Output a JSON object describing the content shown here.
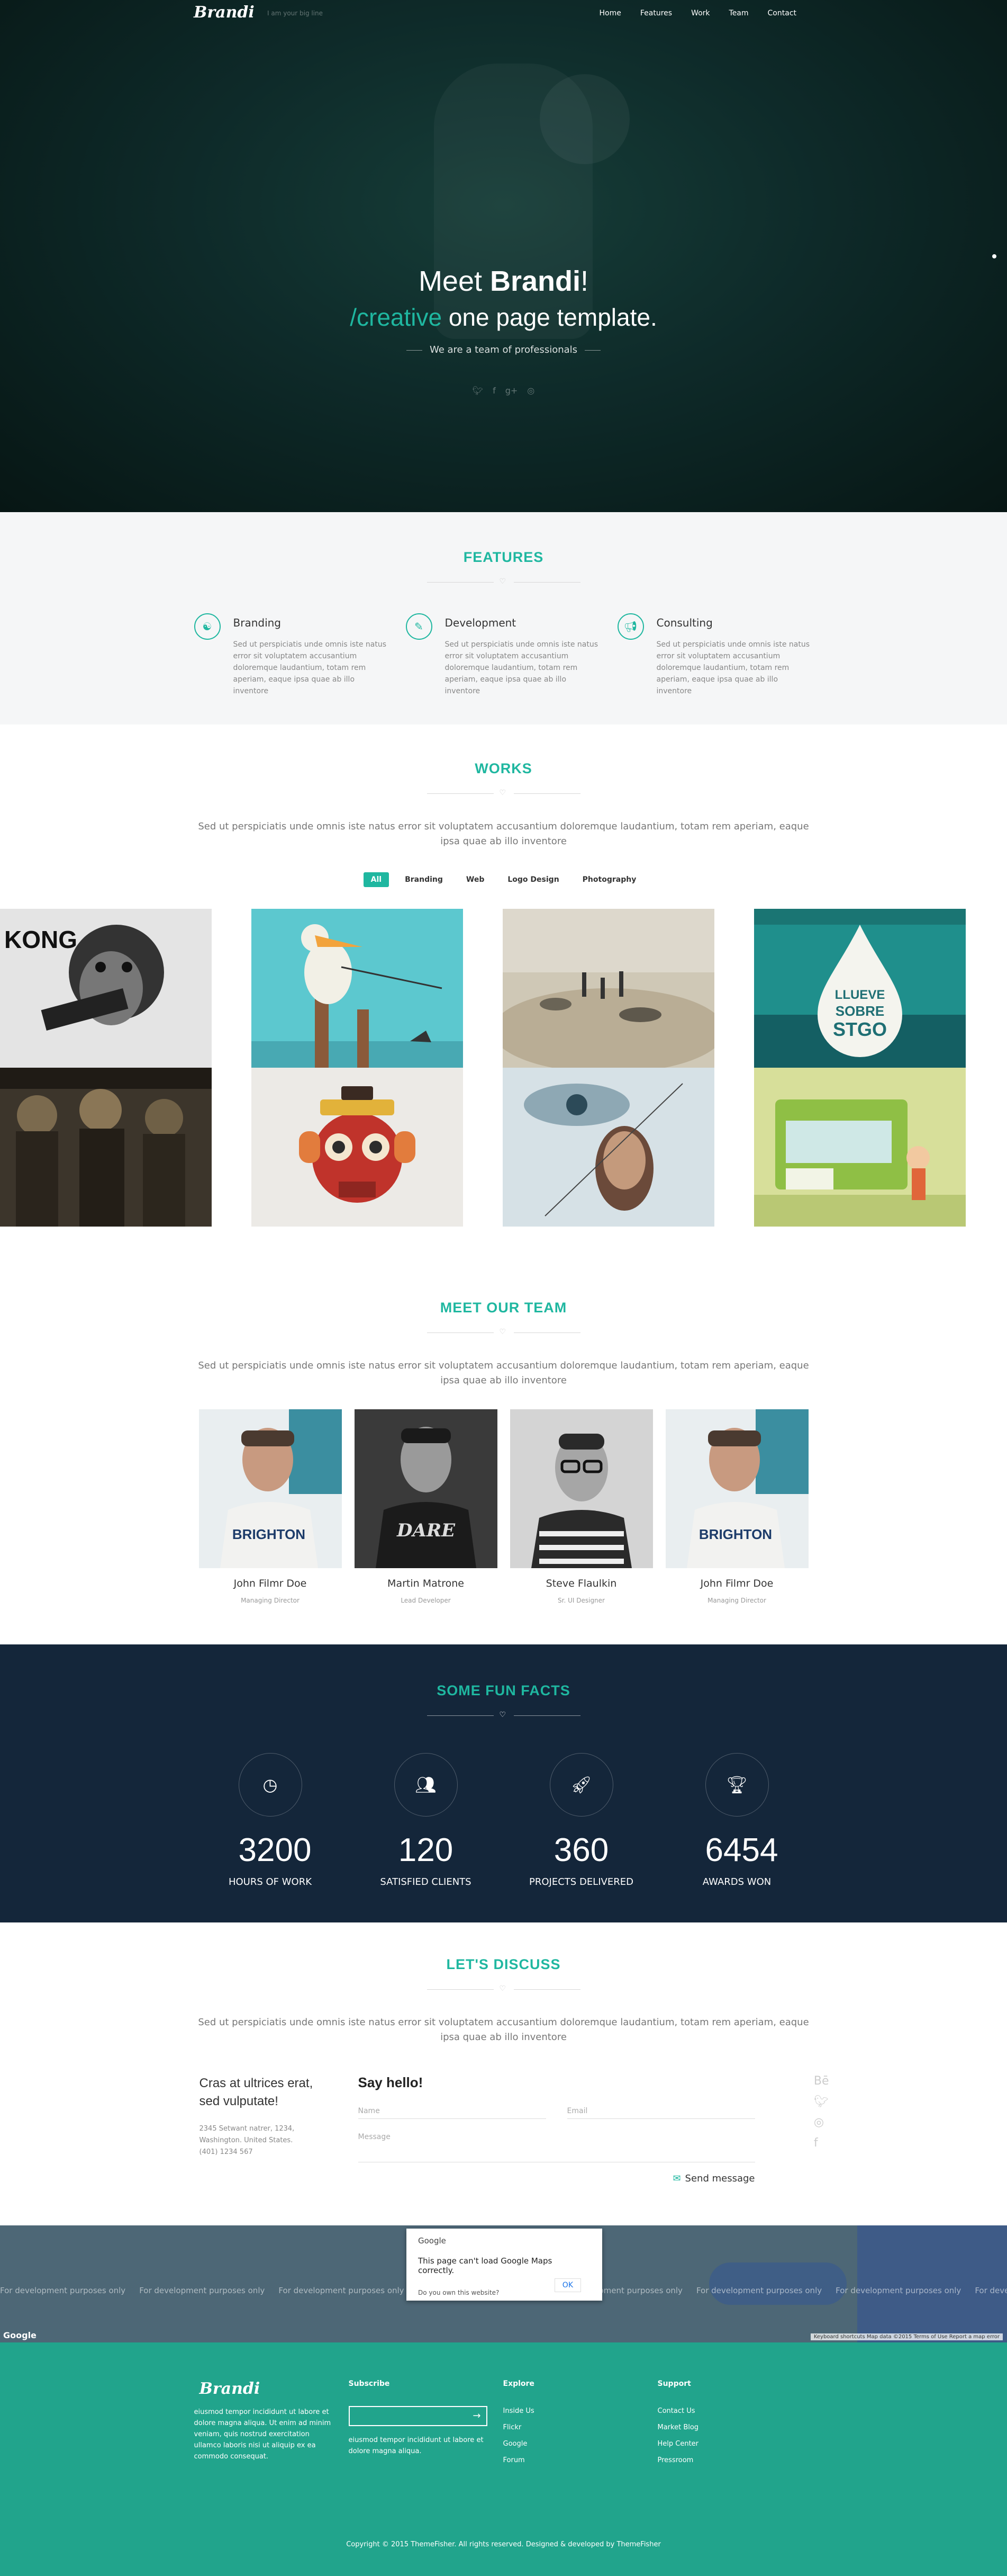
{
  "nav": {
    "logo": "Brandi",
    "tagline": "I am your big line",
    "items": [
      "Home",
      "Features",
      "Work",
      "Team",
      "Contact"
    ]
  },
  "hero": {
    "title_prefix": "Meet ",
    "title_bold": "Brandi",
    "title_suffix": "!",
    "sub_accent": "/creative",
    "sub_rest": " one page template.",
    "team_line": "We are a team of professionals",
    "socials": [
      "twitter-icon",
      "facebook-icon",
      "google-plus-icon",
      "dribbble-icon"
    ]
  },
  "features": {
    "title": "FEATURES",
    "items": [
      {
        "title": "Branding",
        "icon": "github-icon",
        "text": "Sed ut perspiciatis unde omnis iste natus error sit voluptatem accusantium doloremque laudantium, totam rem aperiam, eaque ipsa quae ab illo inventore"
      },
      {
        "title": "Development",
        "icon": "pencil-icon",
        "text": "Sed ut perspiciatis unde omnis iste natus error sit voluptatem accusantium doloremque laudantium, totam rem aperiam, eaque ipsa quae ab illo inventore"
      },
      {
        "title": "Consulting",
        "icon": "megaphone-icon",
        "text": "Sed ut perspiciatis unde omnis iste natus error sit voluptatem accusantium doloremque laudantium, totam rem aperiam, eaque ipsa quae ab illo inventore"
      }
    ]
  },
  "works": {
    "title": "WORKS",
    "intro": "Sed ut perspiciatis unde omnis iste natus error sit voluptatem accusantium doloremque laudantium, totam rem aperiam, eaque ipsa quae ab illo inventore",
    "filters": [
      "All",
      "Branding",
      "Web",
      "Logo Design",
      "Photography"
    ],
    "tile_text": {
      "kong": "KONG",
      "drop1": "LLUEVE",
      "drop2": "SOBRE",
      "drop3": "STGO"
    }
  },
  "team": {
    "title": "MEET OUR TEAM",
    "intro": "Sed ut perspiciatis unde omnis iste natus error sit voluptatem accusantium doloremque laudantium, totam rem aperiam, eaque ipsa quae ab illo inventore",
    "members": [
      {
        "name": "John Filmr Doe",
        "role": "Managing Director",
        "shirt": "BRIGHTON"
      },
      {
        "name": "Martin Matrone",
        "role": "Lead Developer",
        "shirt": "DARE"
      },
      {
        "name": "Steve Flaulkin",
        "role": "Sr. UI Designer",
        "shirt": ""
      },
      {
        "name": "John Filmr Doe",
        "role": "Managing Director",
        "shirt": "BRIGHTON"
      }
    ]
  },
  "facts": {
    "title": "SOME FUN FACTS",
    "items": [
      {
        "value": "3200",
        "label": "HOURS OF WORK",
        "icon": "clock-icon"
      },
      {
        "value": "120",
        "label": "SATISFIED CLIENTS",
        "icon": "users-icon"
      },
      {
        "value": "360",
        "label": "PROJECTS DELIVERED",
        "icon": "rocket-icon"
      },
      {
        "value": "6454",
        "label": "AWARDS WON",
        "icon": "trophy-icon"
      }
    ]
  },
  "contact": {
    "title": "LET'S DISCUSS",
    "intro": "Sed ut perspiciatis unde omnis iste natus error sit voluptatem accusantium doloremque laudantium, totam rem aperiam, eaque ipsa quae ab illo inventore",
    "address_heading": "Cras at ultrices erat, sed vulputate!",
    "address_line1": "2345 Setwant natrer, 1234,",
    "address_line2": "Washington. United States.",
    "address_line3": "(401) 1234 567",
    "form_title": "Say hello!",
    "name_placeholder": "Name",
    "email_placeholder": "Email",
    "message_placeholder": "Message",
    "send_label": "Send message",
    "side_socials": [
      "behance-icon",
      "twitter-icon",
      "dribbble-icon",
      "facebook-icon"
    ]
  },
  "map": {
    "dev_text": "For development purposes only",
    "dialog_brand": "Google",
    "dialog_message": "This page can't load Google Maps correctly.",
    "dialog_question": "Do you own this website?",
    "dialog_ok": "OK",
    "logo": "Google",
    "attribution": "Keyboard shortcuts   Map data ©2015   Terms of Use   Report a map error"
  },
  "footer": {
    "logo": "Brandi",
    "about": "eiusmod tempor incididunt ut labore et dolore magna aliqua. Ut enim ad minim veniam, quis nostrud exercitation ullamco laboris nisi ut aliquip ex ea commodo consequat.",
    "subscribe_title": "Subscribe",
    "subscribe_text": "eiusmod tempor incididunt ut labore et dolore magna aliqua.",
    "explore_title": "Explore",
    "explore_links": [
      "Inside Us",
      "Flickr",
      "Google",
      "Forum"
    ],
    "support_title": "Support",
    "support_links": [
      "Contact Us",
      "Market Blog",
      "Help Center",
      "Pressroom"
    ],
    "copyright": "Copyright © 2015 ThemeFisher. All rights reserved. Designed & developed by ThemeFisher"
  }
}
